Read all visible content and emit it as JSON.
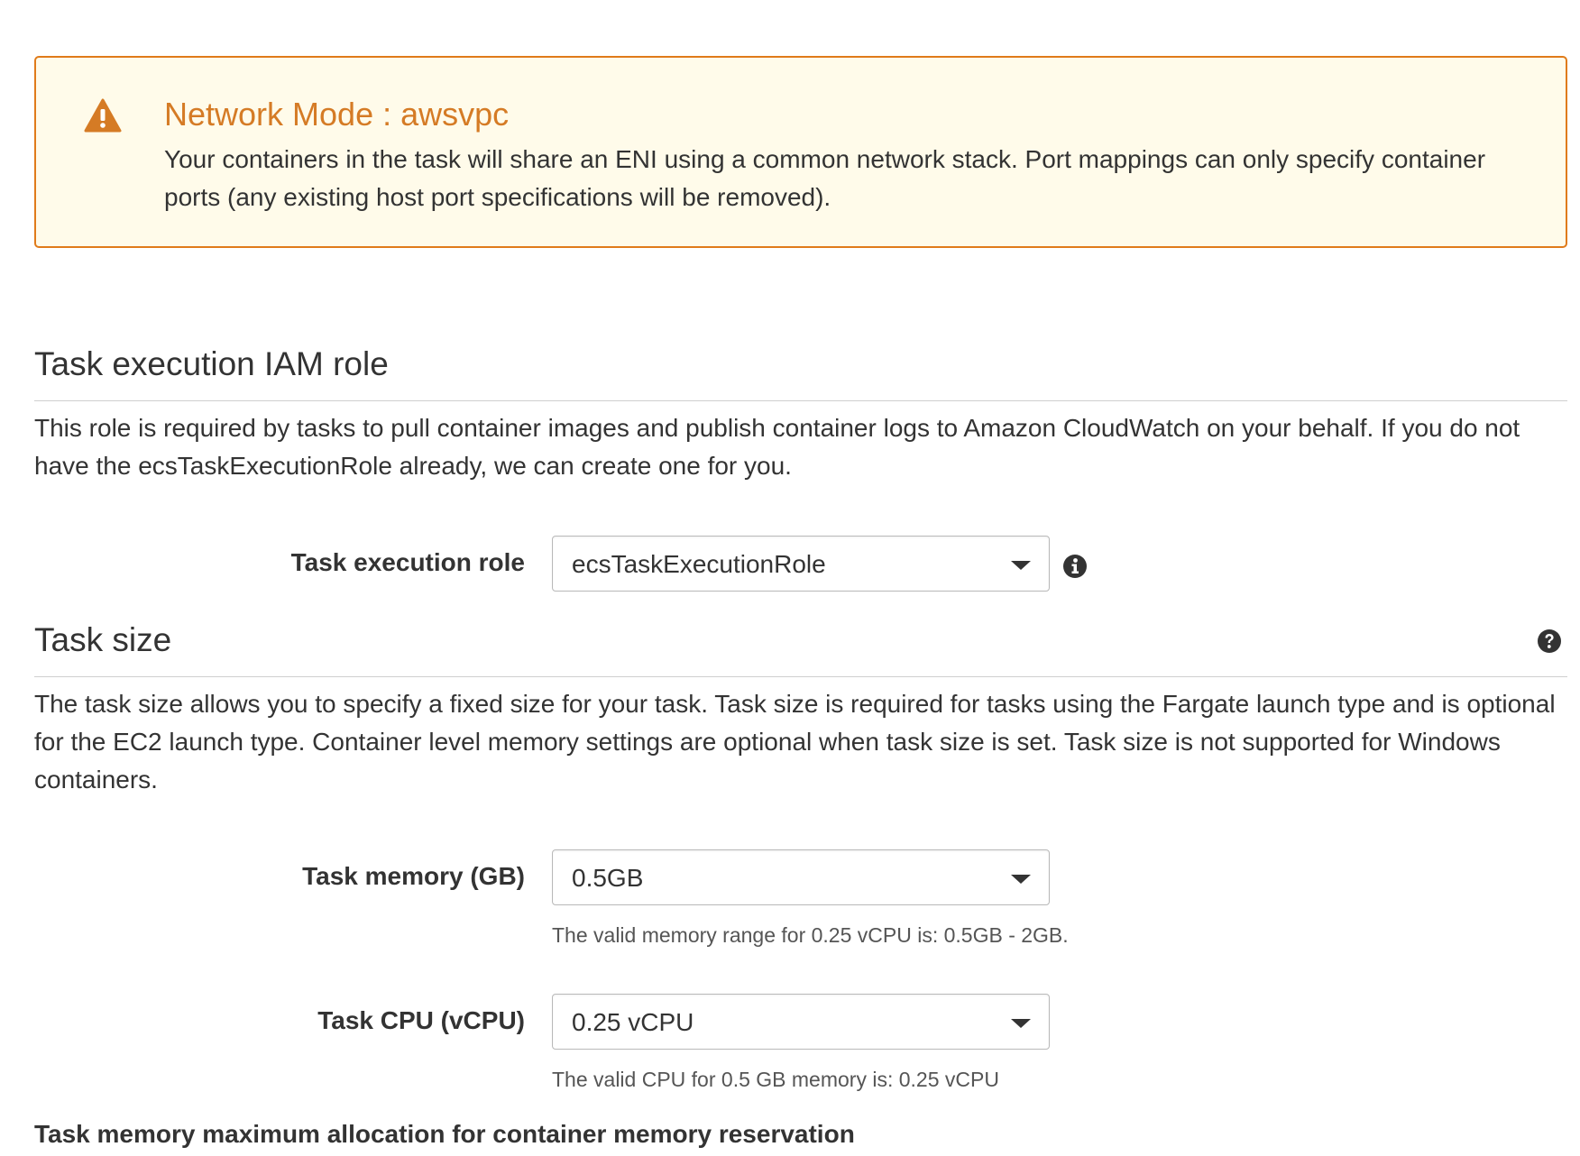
{
  "alert": {
    "icon": "warning-triangle-icon",
    "title": "Network Mode : awsvpc",
    "body": "Your containers in the task will share an ENI using a common network stack. Port mappings can only specify container ports (any existing host port specifications will be removed).",
    "border_color": "#e07b1a",
    "background_color": "#fffbea",
    "title_color": "#d57b25"
  },
  "execution_role_section": {
    "title": "Task execution IAM role",
    "description": "This role is required by tasks to pull container images and publish container logs to Amazon CloudWatch on your behalf. If you do not have the ecsTaskExecutionRole already, we can create one for you.",
    "role_label": "Task execution role",
    "role_value": "ecsTaskExecutionRole",
    "info_icon": "info-circle-icon"
  },
  "task_size_section": {
    "title": "Task size",
    "help_icon": "question-circle-icon",
    "description": "The task size allows you to specify a fixed size for your task. Task size is required for tasks using the Fargate launch type and is optional for the EC2 launch type. Container level memory settings are optional when task size is set. Task size is not supported for Windows containers.",
    "memory_label": "Task memory (GB)",
    "memory_value": "0.5GB",
    "memory_hint": "The valid memory range for 0.25 vCPU is: 0.5GB - 2GB.",
    "cpu_label": "Task CPU (vCPU)",
    "cpu_value": "0.25 vCPU",
    "cpu_hint": "The valid CPU for 0.5 GB memory is: 0.25 vCPU"
  },
  "footer_label": "Task memory maximum allocation for container memory reservation"
}
